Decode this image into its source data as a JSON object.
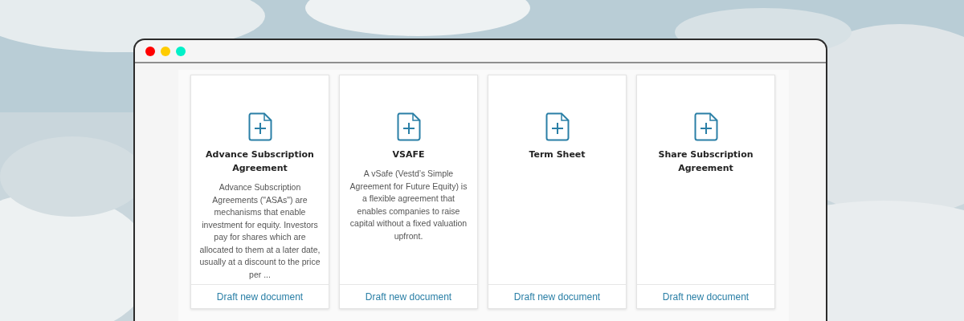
{
  "cards": [
    {
      "title": "Advance Subscription Agreement",
      "description": "Advance Subscription Agreements (\"ASAs\") are mechanisms that enable investment for equity. Investors pay for shares which are allocated to them at a later date, usually at a discount to the price per ...",
      "action": "Draft new document"
    },
    {
      "title": "VSAFE",
      "description": "A vSafe (Vestd’s Simple Agreement for Future Equity) is a flexible agreement that enables companies to raise capital without a fixed valuation upfront.",
      "action": "Draft new document"
    },
    {
      "title": "Term Sheet",
      "action": "Draft new document"
    },
    {
      "title": "Share Subscription Agreement",
      "action": "Draft new document"
    }
  ]
}
